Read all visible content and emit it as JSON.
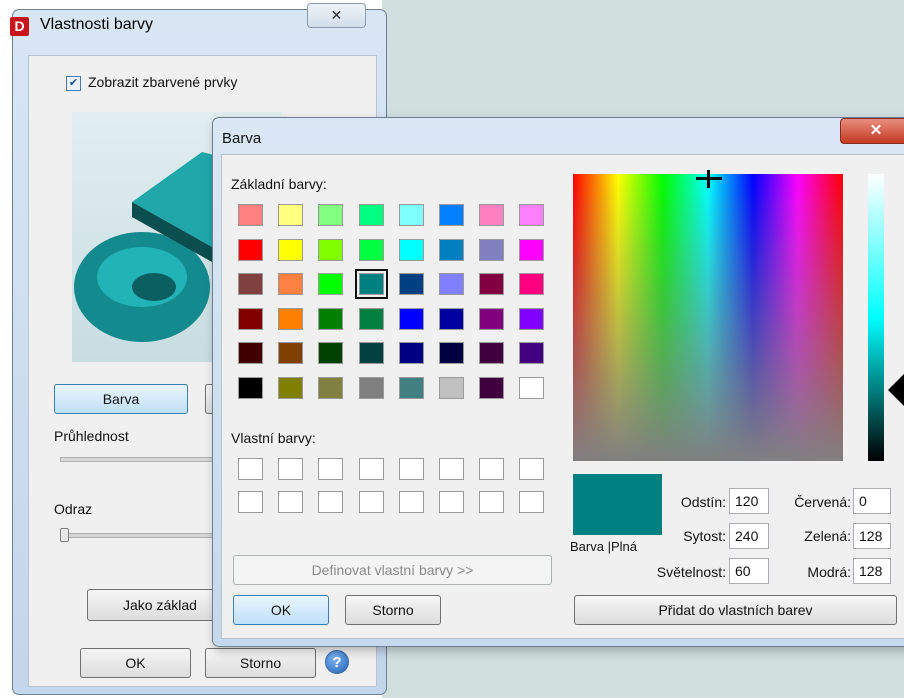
{
  "properties_dialog": {
    "title": "Vlastnosti barvy",
    "app_icon": "D",
    "close_glyph": "✕",
    "show_colored_checkbox": {
      "label": "Zobrazit zbarvené prvky",
      "checked": true
    },
    "color_button": "Barva",
    "transparency_label": "Průhlednost",
    "reflection_label": "Odraz",
    "default_button": "Jako základ",
    "ok_button": "OK",
    "cancel_button": "Storno",
    "help_icon": "?"
  },
  "color_dialog": {
    "title": "Barva",
    "close_glyph": "✕",
    "basic_colors_label": "Základní barvy:",
    "basic_colors": [
      [
        "#ff8080",
        "#ffff80",
        "#80ff80",
        "#00ff80",
        "#80ffff",
        "#0080ff",
        "#ff80c0",
        "#ff80ff"
      ],
      [
        "#ff0000",
        "#ffff00",
        "#80ff00",
        "#00ff40",
        "#00ffff",
        "#0080c0",
        "#8080c0",
        "#ff00ff"
      ],
      [
        "#804040",
        "#ff8040",
        "#00ff00",
        "#008080",
        "#004080",
        "#8080ff",
        "#800040",
        "#ff0080"
      ],
      [
        "#800000",
        "#ff8000",
        "#008000",
        "#008040",
        "#0000ff",
        "#0000a0",
        "#800080",
        "#8000ff"
      ],
      [
        "#400000",
        "#804000",
        "#004000",
        "#004040",
        "#000080",
        "#000040",
        "#400040",
        "#400080"
      ],
      [
        "#000000",
        "#808000",
        "#808040",
        "#808080",
        "#408080",
        "#c0c0c0",
        "#400040",
        "#ffffff"
      ]
    ],
    "selected_basic_color": "#008080",
    "custom_colors_label": "Vlastní barvy:",
    "define_custom_button": "Definovat vlastní barvy >>",
    "ok_button": "OK",
    "cancel_button": "Storno",
    "color_solid_label": "Barva |Plná",
    "hue": {
      "label": "Odstín:",
      "value": "120"
    },
    "saturation": {
      "label": "Sytost:",
      "value": "240"
    },
    "luminance": {
      "label": "Světelnost:",
      "value": "60"
    },
    "red": {
      "label": "Červená:",
      "value": "0"
    },
    "green": {
      "label": "Zelená:",
      "value": "128"
    },
    "blue": {
      "label": "Modrá:",
      "value": "128"
    },
    "add_custom_button": "Přidat do vlastních barev"
  }
}
